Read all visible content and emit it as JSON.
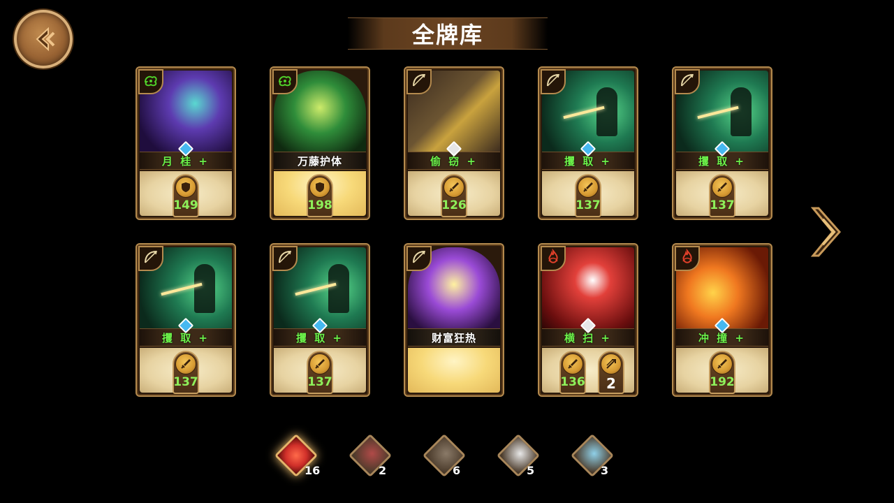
{
  "header": {
    "title": "全牌库"
  },
  "cards": [
    {
      "name": "月 桂 +",
      "art": "moonlaurel",
      "type_icon": "nature-icon",
      "type_color": "#4fd12a",
      "gem": "blue",
      "name_style": "green",
      "body": "plain",
      "stats": [
        {
          "icon": "shield-icon",
          "value": "149"
        }
      ]
    },
    {
      "name": "万藤护体",
      "art": "vines",
      "type_icon": "nature-icon",
      "type_color": "#4fd12a",
      "gem": "none",
      "name_style": "white",
      "body": "gold",
      "stats": [
        {
          "icon": "shield-icon",
          "value": "198"
        }
      ]
    },
    {
      "name": "偷 窃 +",
      "art": "steal",
      "type_icon": "bow-icon",
      "type_color": "#e8d8a8",
      "gem": "white",
      "name_style": "green",
      "body": "plain",
      "stats": [
        {
          "icon": "dagger-icon",
          "value": "126"
        }
      ]
    },
    {
      "name": "攫 取 +",
      "art": "grab",
      "type_icon": "bow-icon",
      "type_color": "#e8d8a8",
      "gem": "blue",
      "name_style": "green",
      "body": "plain",
      "stats": [
        {
          "icon": "dagger-icon",
          "value": "137"
        }
      ]
    },
    {
      "name": "攫 取 +",
      "art": "grab",
      "type_icon": "bow-icon",
      "type_color": "#e8d8a8",
      "gem": "blue",
      "name_style": "green",
      "body": "plain",
      "stats": [
        {
          "icon": "dagger-icon",
          "value": "137"
        }
      ]
    },
    {
      "name": "攫 取 +",
      "art": "grab",
      "type_icon": "bow-icon",
      "type_color": "#e8d8a8",
      "gem": "blue",
      "name_style": "green",
      "body": "plain",
      "stats": [
        {
          "icon": "dagger-icon",
          "value": "137"
        }
      ]
    },
    {
      "name": "攫 取 +",
      "art": "grab",
      "type_icon": "bow-icon",
      "type_color": "#e8d8a8",
      "gem": "blue",
      "name_style": "green",
      "body": "plain",
      "stats": [
        {
          "icon": "dagger-icon",
          "value": "137"
        }
      ]
    },
    {
      "name": "财富狂热",
      "art": "fever",
      "type_icon": "bow-icon",
      "type_color": "#e8d8a8",
      "gem": "none",
      "name_style": "white",
      "body": "gold",
      "stats": []
    },
    {
      "name": "横 扫 +",
      "art": "sweep",
      "type_icon": "fire-icon",
      "type_color": "#e0402a",
      "gem": "white",
      "name_style": "green",
      "body": "plain",
      "stats": [
        {
          "icon": "dagger-icon",
          "value": "136"
        },
        {
          "icon": "multi-arrow-icon",
          "value": "2"
        }
      ]
    },
    {
      "name": "冲 撞 +",
      "art": "charge",
      "type_icon": "fire-icon",
      "type_color": "#e0402a",
      "gem": "blue",
      "name_style": "green",
      "body": "plain",
      "stats": [
        {
          "icon": "dagger-icon",
          "value": "192"
        }
      ]
    }
  ],
  "heroes": [
    {
      "name": "hero-all",
      "count": "16",
      "active": true,
      "color": "#d0302a"
    },
    {
      "name": "hero-redhair",
      "count": "2",
      "active": false,
      "color": "#b04a48"
    },
    {
      "name": "hero-oldman",
      "count": "6",
      "active": false,
      "color": "#8a7a68"
    },
    {
      "name": "hero-panda",
      "count": "5",
      "active": false,
      "color": "#e8e8e8"
    },
    {
      "name": "hero-ghost",
      "count": "3",
      "active": false,
      "color": "#8fd0e8"
    }
  ]
}
